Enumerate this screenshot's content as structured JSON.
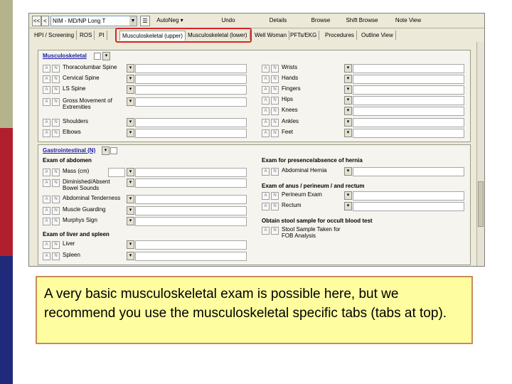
{
  "toolbar": {
    "nav_prev": "<<",
    "nav_prev_single": "<",
    "template": "NIM - MD/NP Long T",
    "autoneg": "AutoNeg",
    "undo": "Undo",
    "details": "Details",
    "browse": "Browse",
    "shift_browse": "Shift Browse",
    "note_view": "Note View"
  },
  "tabs": [
    "HPI / Screening",
    "ROS",
    "PI",
    "Musculoskeletal (upper)",
    "Musculoskeletal (lower)",
    "Well Woman",
    "PFTs/EKG",
    "Procedures",
    "Outline View"
  ],
  "musculoskeletal": {
    "title": "Musculoskeletal",
    "left_items": [
      "Thoracolumbar Spine",
      "Cervical Spine",
      "LS Spine",
      "Gross Movement of Extremities",
      "Shoulders",
      "Elbows"
    ],
    "right_items": [
      "Wrists",
      "Hands",
      "Fingers",
      "Hips",
      "Knees",
      "Ankles",
      "Feet"
    ]
  },
  "gastro": {
    "title": "Gastrointestinal (N)",
    "abdomen_header": "Exam of abdomen",
    "abdomen_items": [
      "Mass (cm)",
      "Diminished/Absent Bowel Sounds",
      "Abdominal Tenderness",
      "Muscle Guarding",
      "Murphys Sign"
    ],
    "liver_header": "Exam of liver and spleen",
    "liver_items": [
      "Liver",
      "Spleen"
    ],
    "hernia_header": "Exam for presence/absence of hernia",
    "hernia_items": [
      "Abdominal Hernia"
    ],
    "anus_header": "Exam of anus / perineum / and rectum",
    "anus_items": [
      "Perineum Exam",
      "Rectum"
    ],
    "stool_header": "Obtain stool sample for occult blood test",
    "stool_items": [
      "Stool Sample Taken for FOB Analysis"
    ]
  },
  "callout": {
    "text": "A very basic musculoskeletal exam is possible here, but we recommend you use the musculoskeletal specific tabs (tabs at top)."
  }
}
